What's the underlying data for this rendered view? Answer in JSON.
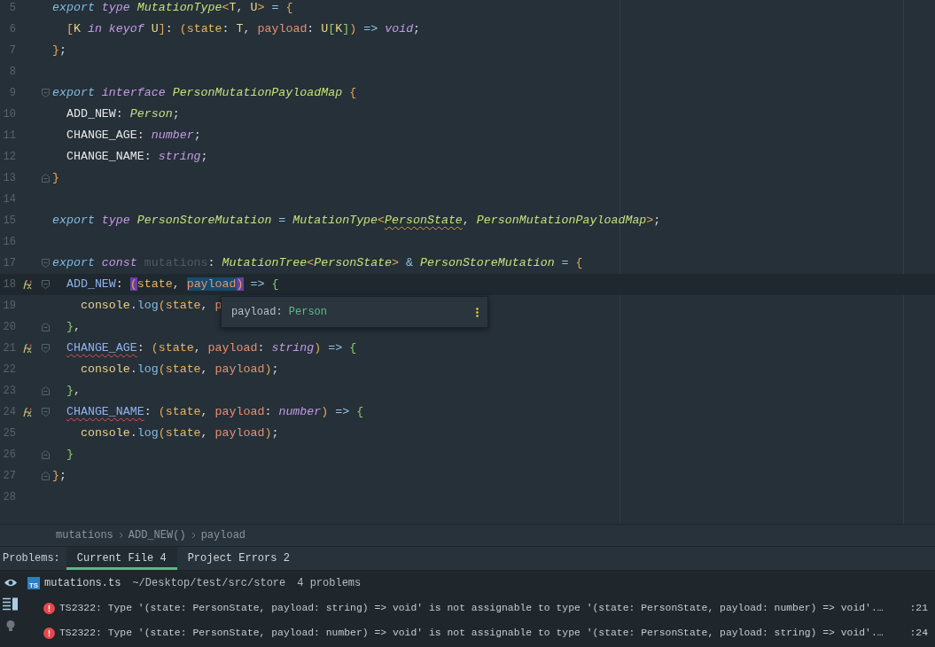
{
  "editor": {
    "lines": [
      {
        "n": "5",
        "tokens": [
          {
            "t": "export ",
            "kind": "kw"
          },
          {
            "t": "type ",
            "kind": "kw2"
          },
          {
            "t": "MutationType",
            "kind": "type"
          },
          {
            "t": "<",
            "kind": "brace"
          },
          {
            "t": "T",
            "kind": "tp"
          },
          {
            "t": ", ",
            "kind": "punct"
          },
          {
            "t": "U",
            "kind": "tp"
          },
          {
            "t": ">",
            "kind": "brace"
          },
          {
            "t": " = ",
            "kind": "op"
          },
          {
            "t": "{",
            "kind": "brace"
          }
        ]
      },
      {
        "n": "6",
        "tokens": [
          {
            "t": "  [",
            "kind": "brace"
          },
          {
            "t": "K ",
            "kind": "tp"
          },
          {
            "t": "in keyof ",
            "kind": "kw2"
          },
          {
            "t": "U",
            "kind": "tp"
          },
          {
            "t": "]",
            "kind": "brace"
          },
          {
            "t": ": ",
            "kind": "punct"
          },
          {
            "t": "(",
            "kind": "brace"
          },
          {
            "t": "state",
            "kind": "state"
          },
          {
            "t": ": ",
            "kind": "punct"
          },
          {
            "t": "T",
            "kind": "tp"
          },
          {
            "t": ", ",
            "kind": "punct"
          },
          {
            "t": "payload",
            "kind": "param"
          },
          {
            "t": ": ",
            "kind": "punct"
          },
          {
            "t": "U",
            "kind": "tp"
          },
          {
            "t": "[",
            "kind": "brace2"
          },
          {
            "t": "K",
            "kind": "tp"
          },
          {
            "t": "]",
            "kind": "brace2"
          },
          {
            "t": ")",
            "kind": "brace"
          },
          {
            "t": " => ",
            "kind": "op"
          },
          {
            "t": "void",
            "kind": "kw2"
          },
          {
            "t": ";",
            "kind": "punct"
          }
        ]
      },
      {
        "n": "7",
        "tokens": [
          {
            "t": "}",
            "kind": "brace"
          },
          {
            "t": ";",
            "kind": "punct"
          }
        ]
      },
      {
        "n": "8"
      },
      {
        "n": "9",
        "fold_start": true,
        "tokens": [
          {
            "t": "export ",
            "kind": "kw"
          },
          {
            "t": "interface ",
            "kind": "kw2"
          },
          {
            "t": "PersonMutationPayloadMap ",
            "kind": "type"
          },
          {
            "t": "{",
            "kind": "brace"
          }
        ]
      },
      {
        "n": "10",
        "tokens": [
          {
            "t": "  ADD_NEW",
            "kind": "prop"
          },
          {
            "t": ": ",
            "kind": "punct"
          },
          {
            "t": "Person",
            "kind": "type"
          },
          {
            "t": ";",
            "kind": "punct"
          }
        ]
      },
      {
        "n": "11",
        "tokens": [
          {
            "t": "  CHANGE_AGE",
            "kind": "prop"
          },
          {
            "t": ": ",
            "kind": "punct"
          },
          {
            "t": "number",
            "kind": "kw2"
          },
          {
            "t": ";",
            "kind": "punct"
          }
        ]
      },
      {
        "n": "12",
        "tokens": [
          {
            "t": "  CHANGE_NAME",
            "kind": "prop"
          },
          {
            "t": ": ",
            "kind": "punct"
          },
          {
            "t": "string",
            "kind": "kw2"
          },
          {
            "t": ";",
            "kind": "punct"
          }
        ]
      },
      {
        "n": "13",
        "fold_end": true,
        "tokens": [
          {
            "t": "}",
            "kind": "brace"
          }
        ]
      },
      {
        "n": "14"
      },
      {
        "n": "15",
        "tokens": [
          {
            "t": "export ",
            "kind": "kw"
          },
          {
            "t": "type ",
            "kind": "kw2"
          },
          {
            "t": "PersonStoreMutation",
            "kind": "type"
          },
          {
            "t": " = ",
            "kind": "op"
          },
          {
            "t": "MutationType",
            "kind": "type"
          },
          {
            "t": "<",
            "kind": "brace"
          },
          {
            "t": "PersonState",
            "kind": "type",
            "warning": true
          },
          {
            "t": ", ",
            "kind": "punct"
          },
          {
            "t": "PersonMutationPayloadMap",
            "kind": "type"
          },
          {
            "t": ">",
            "kind": "brace"
          },
          {
            "t": ";",
            "kind": "punct"
          }
        ]
      },
      {
        "n": "16"
      },
      {
        "n": "17",
        "fold_start": true,
        "tokens": [
          {
            "t": "export ",
            "kind": "kw"
          },
          {
            "t": "const ",
            "kind": "kw2"
          },
          {
            "t": "mutations",
            "kind": "dim"
          },
          {
            "t": ": ",
            "kind": "punct"
          },
          {
            "t": "MutationTree",
            "kind": "type"
          },
          {
            "t": "<",
            "kind": "brace"
          },
          {
            "t": "PersonState",
            "kind": "type"
          },
          {
            "t": ">",
            "kind": "brace"
          },
          {
            "t": " & ",
            "kind": "op"
          },
          {
            "t": "PersonStoreMutation",
            "kind": "type"
          },
          {
            "t": " = ",
            "kind": "op"
          },
          {
            "t": "{",
            "kind": "brace"
          }
        ]
      },
      {
        "n": "18",
        "current": true,
        "gutter_icon": true,
        "fold_start": true,
        "tokens": [
          {
            "t": "  ADD_NEW",
            "kind": "key"
          },
          {
            "t": ": ",
            "kind": "punct"
          },
          {
            "t": "(",
            "kind": "brace",
            "matched": true
          },
          {
            "t": "state",
            "kind": "state"
          },
          {
            "t": ", ",
            "kind": "punct"
          },
          {
            "t": "payload",
            "kind": "param",
            "selected": true
          },
          {
            "t": ")",
            "kind": "brace",
            "matched": true
          },
          {
            "t": " => ",
            "kind": "op"
          },
          {
            "t": "{",
            "kind": "brace2"
          }
        ]
      },
      {
        "n": "19",
        "tokens": [
          {
            "t": "    console",
            "kind": "obj"
          },
          {
            "t": ".",
            "kind": "punct"
          },
          {
            "t": "log",
            "kind": "method"
          },
          {
            "t": "(",
            "kind": "brace"
          },
          {
            "t": "state",
            "kind": "state"
          },
          {
            "t": ", ",
            "kind": "punct"
          },
          {
            "t": "p",
            "kind": "param"
          }
        ]
      },
      {
        "n": "20",
        "fold_end": true,
        "tokens": [
          {
            "t": "  }",
            "kind": "brace2"
          },
          {
            "t": ",",
            "kind": "punct"
          }
        ]
      },
      {
        "n": "21",
        "gutter_icon": true,
        "fold_start": true,
        "tokens": [
          {
            "t": "  CHANGE_AGE",
            "kind": "key",
            "error": true
          },
          {
            "t": ": ",
            "kind": "punct"
          },
          {
            "t": "(",
            "kind": "brace"
          },
          {
            "t": "state",
            "kind": "state"
          },
          {
            "t": ", ",
            "kind": "punct"
          },
          {
            "t": "payload",
            "kind": "param"
          },
          {
            "t": ": ",
            "kind": "punct"
          },
          {
            "t": "string",
            "kind": "kw2"
          },
          {
            "t": ")",
            "kind": "brace"
          },
          {
            "t": " => ",
            "kind": "op"
          },
          {
            "t": "{",
            "kind": "brace2"
          }
        ]
      },
      {
        "n": "22",
        "tokens": [
          {
            "t": "    console",
            "kind": "obj"
          },
          {
            "t": ".",
            "kind": "punct"
          },
          {
            "t": "log",
            "kind": "method"
          },
          {
            "t": "(",
            "kind": "brace"
          },
          {
            "t": "state",
            "kind": "state"
          },
          {
            "t": ", ",
            "kind": "punct"
          },
          {
            "t": "payload",
            "kind": "param"
          },
          {
            "t": ")",
            "kind": "brace"
          },
          {
            "t": ";",
            "kind": "punct"
          }
        ]
      },
      {
        "n": "23",
        "fold_end": true,
        "tokens": [
          {
            "t": "  }",
            "kind": "brace2"
          },
          {
            "t": ",",
            "kind": "punct"
          }
        ]
      },
      {
        "n": "24",
        "gutter_icon": true,
        "fold_start": true,
        "tokens": [
          {
            "t": "  CHANGE_NAME",
            "kind": "key",
            "error": true
          },
          {
            "t": ": ",
            "kind": "punct"
          },
          {
            "t": "(",
            "kind": "brace"
          },
          {
            "t": "state",
            "kind": "state"
          },
          {
            "t": ", ",
            "kind": "punct"
          },
          {
            "t": "payload",
            "kind": "param"
          },
          {
            "t": ": ",
            "kind": "punct"
          },
          {
            "t": "number",
            "kind": "kw2"
          },
          {
            "t": ")",
            "kind": "brace"
          },
          {
            "t": " => ",
            "kind": "op"
          },
          {
            "t": "{",
            "kind": "brace2"
          }
        ]
      },
      {
        "n": "25",
        "tokens": [
          {
            "t": "    console",
            "kind": "obj"
          },
          {
            "t": ".",
            "kind": "punct"
          },
          {
            "t": "log",
            "kind": "method"
          },
          {
            "t": "(",
            "kind": "brace"
          },
          {
            "t": "state",
            "kind": "state"
          },
          {
            "t": ", ",
            "kind": "punct"
          },
          {
            "t": "payload",
            "kind": "param"
          },
          {
            "t": ")",
            "kind": "brace"
          },
          {
            "t": ";",
            "kind": "punct"
          }
        ]
      },
      {
        "n": "26",
        "fold_end": true,
        "tokens": [
          {
            "t": "  }",
            "kind": "brace2"
          }
        ]
      },
      {
        "n": "27",
        "fold_end": true,
        "tokens": [
          {
            "t": "}",
            "kind": "brace"
          },
          {
            "t": ";",
            "kind": "punct"
          }
        ]
      },
      {
        "n": "28"
      }
    ],
    "tooltip": {
      "name": "payload:",
      "type": "Person"
    }
  },
  "breadcrumb": [
    "mutations",
    "ADD_NEW()",
    "payload"
  ],
  "problems": {
    "label": "Problems:",
    "tabs": [
      {
        "label": "Current File 4",
        "selected": true
      },
      {
        "label": "Project Errors 2",
        "selected": false
      }
    ],
    "file": {
      "badge": "TS",
      "name": "mutations.ts",
      "path": "~/Desktop/test/src/store",
      "count": "4 problems"
    },
    "items": [
      {
        "message": "TS2322: Type '(state: PersonState, payload: string) => void' is not assignable to type '(state: PersonState, payload: number) => void'.…",
        "line": ":21"
      },
      {
        "message": "TS2322: Type '(state: PersonState, payload: number) => void' is not assignable to type '(state: PersonState, payload: string) => void'.…",
        "line": ":24"
      }
    ]
  }
}
